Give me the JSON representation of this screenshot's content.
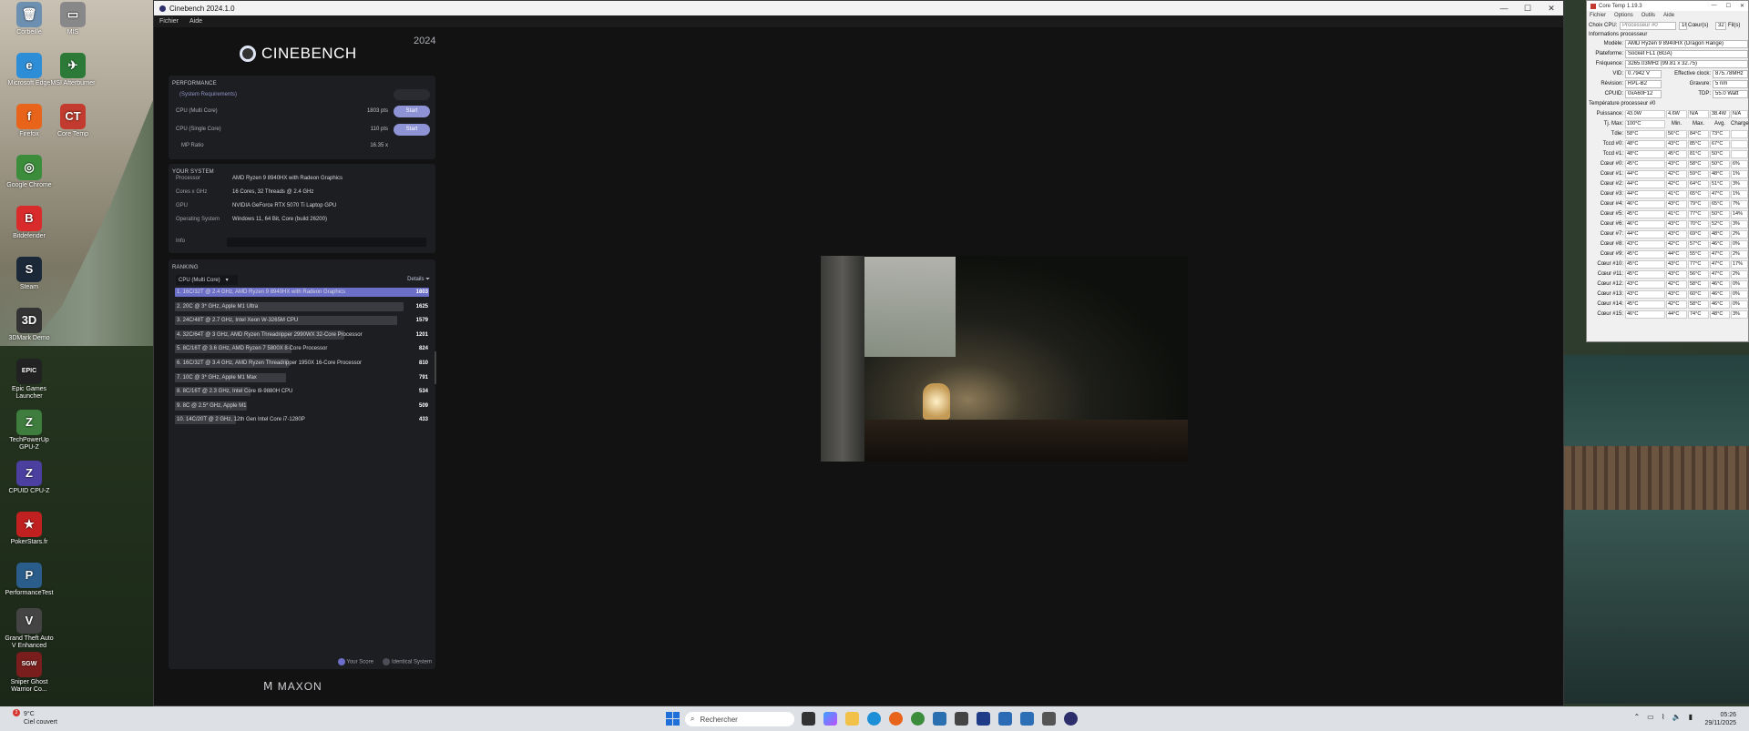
{
  "desktop": {
    "icons": [
      {
        "label": "Corbeille",
        "color": "#6d8fb0",
        "glyph": "🗑"
      },
      {
        "label": "Microsoft Edge",
        "color": "#2d8dd6",
        "glyph": "e"
      },
      {
        "label": "Firefox",
        "color": "#e8641b",
        "glyph": "f"
      },
      {
        "label": "Google Chrome",
        "color": "#3b8d3b",
        "glyph": "◎"
      },
      {
        "label": "Bitdefender",
        "color": "#d92b2b",
        "glyph": "B"
      },
      {
        "label": "Steam",
        "color": "#1b2838",
        "glyph": "S"
      },
      {
        "label": "3DMark Demo",
        "color": "#333",
        "glyph": "3D"
      },
      {
        "label": "Epic Games Launcher",
        "color": "#222",
        "glyph": "EPIC"
      },
      {
        "label": "TechPowerUp GPU-Z",
        "color": "#3e7d3e",
        "glyph": "Z"
      },
      {
        "label": "CPUID CPU-Z",
        "color": "#4b3fa0",
        "glyph": "Z"
      },
      {
        "label": "PokerStars.fr",
        "color": "#c02020",
        "glyph": "★"
      },
      {
        "label": "PerformanceTest",
        "color": "#2b5d8a",
        "glyph": "P"
      },
      {
        "label": "Grand Theft Auto V Enhanced",
        "color": "#444",
        "glyph": "V"
      },
      {
        "label": "Sniper Ghost Warrior Co...",
        "color": "#7a1d1d",
        "glyph": "SGW"
      },
      {
        "label": "MIS",
        "color": "#888",
        "glyph": "▭"
      },
      {
        "label": "MSI Afterburner",
        "color": "#2d7a38",
        "glyph": "✈"
      },
      {
        "label": "Core Temp",
        "color": "#c23b2e",
        "glyph": "CT"
      }
    ]
  },
  "cinebench": {
    "title": "Cinebench 2024.1.0",
    "menu": [
      "Fichier",
      "Aide"
    ],
    "logo": "CINEBENCH",
    "year": "2024",
    "performance": {
      "heading": "PERFORMANCE",
      "sysreq": "(System Requirements)",
      "rows": [
        {
          "label": "CPU (Multi Core)",
          "score": "1803 pts",
          "button": "Start"
        },
        {
          "label": "CPU (Single Core)",
          "score": "110 pts",
          "button": "Start"
        }
      ],
      "mp_label": "MP Ratio",
      "mp_value": "16.35 x"
    },
    "system": {
      "heading": "YOUR SYSTEM",
      "rows": [
        {
          "label": "Processor",
          "value": "AMD Ryzen 9 8940HX with Radeon Graphics"
        },
        {
          "label": "Cores x GHz",
          "value": "16 Cores, 32 Threads @ 2.4 GHz"
        },
        {
          "label": "GPU",
          "value": "NVIDIA GeForce RTX 5070 Ti Laptop GPU"
        },
        {
          "label": "Operating System",
          "value": "Windows 11, 64 Bit, Core (build 26200)"
        },
        {
          "label": "Info",
          "value": ""
        }
      ]
    },
    "ranking": {
      "heading": "RANKING",
      "dropdown": "CPU (Multi Core)",
      "details": "Details",
      "max": 1803,
      "items": [
        {
          "label": "1. 16C/32T @ 2.4 GHz, AMD Ryzen 9 8940HX with Radeon Graphics",
          "value": 1803,
          "highlight": true
        },
        {
          "label": "2. 20C @ 3* GHz, Apple M1 Ultra",
          "value": 1625
        },
        {
          "label": "3. 24C/48T @ 2.7 GHz, Intel Xeon W-3265M CPU",
          "value": 1579
        },
        {
          "label": "4. 32C/64T @ 3 GHz, AMD Ryzen Threadripper 2990WX 32-Core Processor",
          "value": 1201
        },
        {
          "label": "5. 8C/16T @ 3.6 GHz, AMD Ryzen 7 5800X 8-Core Processor",
          "value": 824
        },
        {
          "label": "6. 16C/32T @ 3.4 GHz, AMD Ryzen Threadripper 1950X 16-Core Processor",
          "value": 810
        },
        {
          "label": "7. 10C @ 3* GHz, Apple M1 Max",
          "value": 791
        },
        {
          "label": "8. 8C/16T @ 2.3 GHz, Intel Core i9-9880H CPU",
          "value": 534
        },
        {
          "label": "9. 8C @ 2.5* GHz, Apple M1",
          "value": 509
        },
        {
          "label": "10. 14C/20T @ 2 GHz, 12th Gen Intel Core i7-1280P",
          "value": 433
        }
      ],
      "legend": {
        "your": "Your Score",
        "identical": "Identical System"
      },
      "colors": {
        "highlight": "#6b6fc8",
        "bar": "#3b3c42"
      }
    },
    "footer": "MAXON"
  },
  "coretemp": {
    "title": "Core Temp 1.19.3",
    "menu": [
      "Fichier",
      "Options",
      "Outils",
      "Aide"
    ],
    "select_label": "Choix CPU:",
    "select_value": "Processeur #0",
    "cores": "16",
    "cores_label": "Cœur(s)",
    "threads": "32",
    "threads_label": "Fil(s)",
    "info_heading": "Informations processeur",
    "info": [
      {
        "label": "Modèle:",
        "value": "AMD Ryzen 9 8940HX (Dragon Range)"
      },
      {
        "label": "Plateforme:",
        "value": "Socket FL1 (BGA)"
      },
      {
        "label": "Fréquence:",
        "value": "3265.03MHz (99.81 x 32.75)"
      }
    ],
    "vid_label": "VID:",
    "vid": "0.7942 V",
    "eff_label": "Effective clock:",
    "eff": "875.78MHz",
    "rev_label": "Révision:",
    "rev": "RPL-B2",
    "grav_label": "Gravure:",
    "grav": "5 nm",
    "cpuid_label": "CPUID:",
    "cpuid": "0xA60F12",
    "tdp_label": "TDP:",
    "tdp": "55.0 Watt",
    "temp_heading": "Température processeur #0",
    "power": {
      "label": "Puissance:",
      "vals": [
        "43.0W",
        "4.6W",
        "N/A",
        "38.4W",
        "N/A"
      ]
    },
    "tjmax": {
      "label": "Tj. Max:",
      "value": "100°C",
      "cols": [
        "Min.",
        "Max.",
        "Avg.",
        "Charge"
      ]
    },
    "rows": [
      {
        "label": "Tdie:",
        "cur": "58°C",
        "min": "56°C",
        "max": "84°C",
        "avg": "73°C",
        "load": ""
      },
      {
        "label": "Tccd #0:",
        "cur": "48°C",
        "min": "43°C",
        "max": "85°C",
        "avg": "67°C",
        "load": ""
      },
      {
        "label": "Tccd #1:",
        "cur": "48°C",
        "min": "45°C",
        "max": "81°C",
        "avg": "50°C",
        "load": ""
      },
      {
        "label": "Cœur #0:",
        "cur": "45°C",
        "min": "43°C",
        "max": "58°C",
        "avg": "50°C",
        "load": "6%"
      },
      {
        "label": "Cœur #1:",
        "cur": "44°C",
        "min": "42°C",
        "max": "59°C",
        "avg": "48°C",
        "load": "1%"
      },
      {
        "label": "Cœur #2:",
        "cur": "44°C",
        "min": "42°C",
        "max": "64°C",
        "avg": "51°C",
        "load": "3%"
      },
      {
        "label": "Cœur #3:",
        "cur": "44°C",
        "min": "41°C",
        "max": "65°C",
        "avg": "47°C",
        "load": "1%"
      },
      {
        "label": "Cœur #4:",
        "cur": "46°C",
        "min": "43°C",
        "max": "79°C",
        "avg": "65°C",
        "load": "7%"
      },
      {
        "label": "Cœur #5:",
        "cur": "45°C",
        "min": "41°C",
        "max": "77°C",
        "avg": "50°C",
        "load": "14%"
      },
      {
        "label": "Cœur #6:",
        "cur": "46°C",
        "min": "43°C",
        "max": "70°C",
        "avg": "52°C",
        "load": "3%"
      },
      {
        "label": "Cœur #7:",
        "cur": "44°C",
        "min": "43°C",
        "max": "69°C",
        "avg": "48°C",
        "load": "2%"
      },
      {
        "label": "Cœur #8:",
        "cur": "43°C",
        "min": "42°C",
        "max": "57°C",
        "avg": "46°C",
        "load": "0%"
      },
      {
        "label": "Cœur #9:",
        "cur": "45°C",
        "min": "44°C",
        "max": "55°C",
        "avg": "47°C",
        "load": "2%"
      },
      {
        "label": "Cœur #10:",
        "cur": "45°C",
        "min": "43°C",
        "max": "77°C",
        "avg": "47°C",
        "load": "17%"
      },
      {
        "label": "Cœur #11:",
        "cur": "45°C",
        "min": "43°C",
        "max": "56°C",
        "avg": "47°C",
        "load": "2%"
      },
      {
        "label": "Cœur #12:",
        "cur": "43°C",
        "min": "42°C",
        "max": "58°C",
        "avg": "46°C",
        "load": "0%"
      },
      {
        "label": "Cœur #13:",
        "cur": "43°C",
        "min": "43°C",
        "max": "60°C",
        "avg": "46°C",
        "load": "0%"
      },
      {
        "label": "Cœur #14:",
        "cur": "45°C",
        "min": "42°C",
        "max": "58°C",
        "avg": "46°C",
        "load": "0%"
      },
      {
        "label": "Cœur #15:",
        "cur": "46°C",
        "min": "44°C",
        "max": "74°C",
        "avg": "48°C",
        "load": "3%"
      }
    ]
  },
  "taskbar": {
    "weather_temp": "9°C",
    "weather_desc": "Ciel couvert",
    "badge": "2",
    "search": "Rechercher",
    "time": "05:26",
    "date": "29/11/2025"
  }
}
